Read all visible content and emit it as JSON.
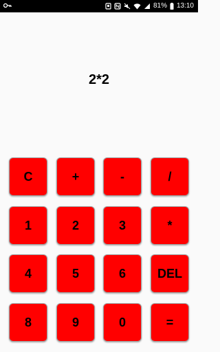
{
  "status_bar": {
    "battery_percent": "81%",
    "time": "13:10",
    "icons": [
      "key-icon",
      "alarm-icon",
      "nfc-icon",
      "mute-icon",
      "wifi-icon",
      "signal-icon",
      "battery-icon"
    ]
  },
  "display": {
    "expression": "2*2"
  },
  "keypad": {
    "rows": [
      [
        "C",
        "+",
        "-",
        "/"
      ],
      [
        "1",
        "2",
        "3",
        "*"
      ],
      [
        "4",
        "5",
        "6",
        "DEL"
      ],
      [
        "8",
        "9",
        "0",
        "="
      ]
    ]
  },
  "colors": {
    "key_background": "#ff0000",
    "page_background": "#fafafa"
  }
}
